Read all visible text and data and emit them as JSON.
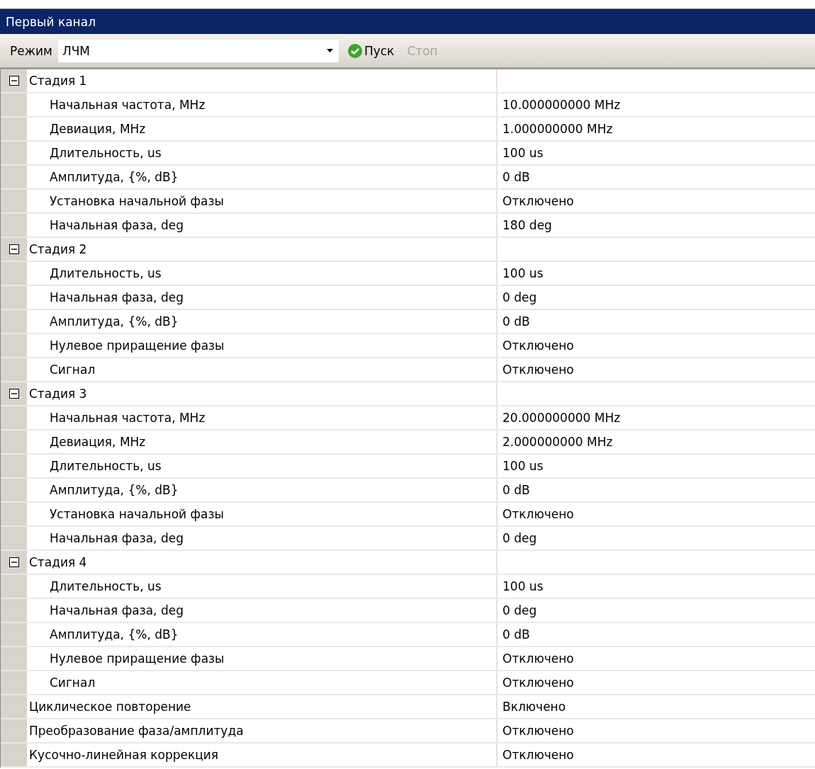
{
  "window": {
    "title": "Первый канал"
  },
  "toolbar": {
    "mode_label": "Режим",
    "mode_value": "ЛЧМ",
    "start_button": {
      "label": "Пуск",
      "disabled": false
    },
    "stop_button": {
      "label": "Стоп",
      "disabled": true
    }
  },
  "property_grid": [
    {
      "kind": "category",
      "name": "Стадия 1",
      "expanded": true,
      "children": [
        {
          "name": "Начальная частота, MHz",
          "value": "10.000000000 MHz"
        },
        {
          "name": "Девиация, MHz",
          "value": "1.000000000 MHz"
        },
        {
          "name": "Длительность, us",
          "value": "100 us"
        },
        {
          "name": "Амплитуда, {%, dB}",
          "value": "0 dB"
        },
        {
          "name": "Установка начальной фазы",
          "value": "Отключено"
        },
        {
          "name": "Начальная фаза, deg",
          "value": "180 deg"
        }
      ]
    },
    {
      "kind": "category",
      "name": "Стадия 2",
      "expanded": true,
      "children": [
        {
          "name": "Длительность, us",
          "value": "100 us"
        },
        {
          "name": "Начальная фаза, deg",
          "value": "0 deg"
        },
        {
          "name": "Амплитуда, {%, dB}",
          "value": "0 dB"
        },
        {
          "name": "Нулевое приращение фазы",
          "value": "Отключено"
        },
        {
          "name": "Сигнал",
          "value": "Отключено"
        }
      ]
    },
    {
      "kind": "category",
      "name": "Стадия 3",
      "expanded": true,
      "children": [
        {
          "name": "Начальная частота, MHz",
          "value": "20.000000000 MHz"
        },
        {
          "name": "Девиация, MHz",
          "value": "2.000000000 MHz"
        },
        {
          "name": "Длительность, us",
          "value": "100 us"
        },
        {
          "name": "Амплитуда, {%, dB}",
          "value": "0 dB"
        },
        {
          "name": "Установка начальной фазы",
          "value": "Отключено"
        },
        {
          "name": "Начальная фаза, deg",
          "value": "0 deg"
        }
      ]
    },
    {
      "kind": "category",
      "name": "Стадия 4",
      "expanded": true,
      "children": [
        {
          "name": "Длительность, us",
          "value": "100 us"
        },
        {
          "name": "Начальная фаза, deg",
          "value": "0 deg"
        },
        {
          "name": "Амплитуда, {%, dB}",
          "value": "0 dB"
        },
        {
          "name": "Нулевое приращение фазы",
          "value": "Отключено"
        },
        {
          "name": "Сигнал",
          "value": "Отключено"
        }
      ]
    },
    {
      "kind": "property",
      "name": "Циклическое повторение",
      "value": "Включено"
    },
    {
      "kind": "property",
      "name": "Преобразование фаза/амплитуда",
      "value": "Отключено"
    },
    {
      "kind": "property",
      "name": "Кусочно-линейная коррекция",
      "value": "Отключено"
    }
  ]
}
